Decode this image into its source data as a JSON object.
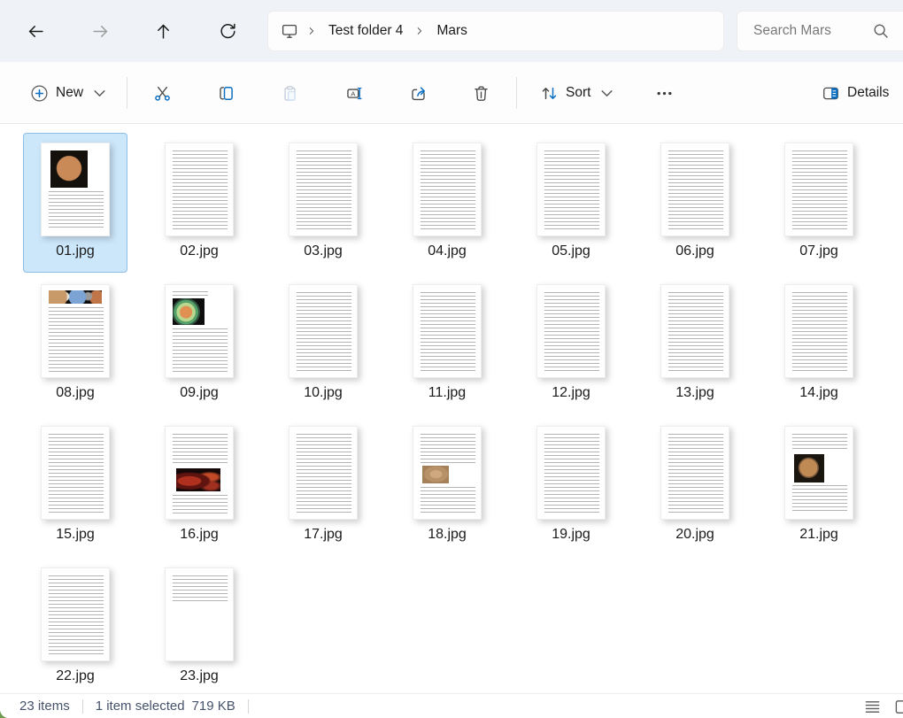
{
  "navbar": {
    "breadcrumb": [
      "Test folder 4",
      "Mars"
    ],
    "search_placeholder": "Search Mars"
  },
  "toolbar": {
    "new_label": "New",
    "sort_label": "Sort",
    "details_label": "Details"
  },
  "files": [
    {
      "name": "01.jpg",
      "selected": true,
      "thumb": "mars-photo-top"
    },
    {
      "name": "02.jpg",
      "selected": false,
      "thumb": "text"
    },
    {
      "name": "03.jpg",
      "selected": false,
      "thumb": "text"
    },
    {
      "name": "04.jpg",
      "selected": false,
      "thumb": "text"
    },
    {
      "name": "05.jpg",
      "selected": false,
      "thumb": "text"
    },
    {
      "name": "06.jpg",
      "selected": false,
      "thumb": "text"
    },
    {
      "name": "07.jpg",
      "selected": false,
      "thumb": "text"
    },
    {
      "name": "08.jpg",
      "selected": false,
      "thumb": "planets-banner"
    },
    {
      "name": "09.jpg",
      "selected": false,
      "thumb": "interior-diagram"
    },
    {
      "name": "10.jpg",
      "selected": false,
      "thumb": "text"
    },
    {
      "name": "11.jpg",
      "selected": false,
      "thumb": "text"
    },
    {
      "name": "12.jpg",
      "selected": false,
      "thumb": "text"
    },
    {
      "name": "13.jpg",
      "selected": false,
      "thumb": "text"
    },
    {
      "name": "14.jpg",
      "selected": false,
      "thumb": "text"
    },
    {
      "name": "15.jpg",
      "selected": false,
      "thumb": "text"
    },
    {
      "name": "16.jpg",
      "selected": false,
      "thumb": "red-map"
    },
    {
      "name": "17.jpg",
      "selected": false,
      "thumb": "text"
    },
    {
      "name": "18.jpg",
      "selected": false,
      "thumb": "tan-photo"
    },
    {
      "name": "19.jpg",
      "selected": false,
      "thumb": "text"
    },
    {
      "name": "20.jpg",
      "selected": false,
      "thumb": "text"
    },
    {
      "name": "21.jpg",
      "selected": false,
      "thumb": "tan-globe"
    },
    {
      "name": "22.jpg",
      "selected": false,
      "thumb": "text"
    },
    {
      "name": "23.jpg",
      "selected": false,
      "thumb": "text-short"
    }
  ],
  "statusbar": {
    "total": "23 items",
    "selection": "1 item selected",
    "size": "719 KB"
  },
  "colors": {
    "accent": "#0b6fc2",
    "selection_bg": "#cce6fa",
    "selection_border": "#8ebfe8",
    "navbar_bg": "#eff2f6"
  }
}
